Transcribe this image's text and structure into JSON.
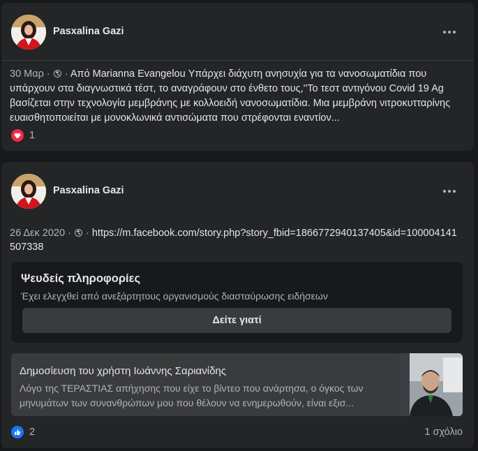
{
  "posts": [
    {
      "author": "Pasxalina Gazi",
      "date": "30 Μαρ",
      "separator": "·",
      "text": "Από Marianna Evangelou Υπάρχει διάχυτη ανησυχία για τα νανοσωματίδια που υπάρχουν στα διαγνωστικά τέστ, το αναγράφουν στο ένθετο τους,''Το τεστ αντιγόνου Covid 19 Ag βασίζεται στην τεχνολογία μεμβράνης με κολλοειδή νανοσωματίδια. Μια μεμβράνη νιτροκυτταρίνης ευαισθητοποιείται με μονοκλωνικά αντισώματα που στρέφονται εναντίον...",
      "reaction_icon": "love-icon",
      "reaction_count": "1"
    },
    {
      "author": "Pasxalina Gazi",
      "date": "26 Δεκ 2020",
      "separator": "·",
      "url": "https://m.facebook.com/story.php?story_fbid=1866772940137405&id=100004141507338",
      "fact_check": {
        "title": "Ψευδείς πληροφορίες",
        "subtitle": "Έχει ελεγχθεί από ανεξάρτητους οργανισμούς διασταύρωσης ειδήσεων",
        "button": "Δείτε γιατί"
      },
      "shared": {
        "title": "Δημοσίευση του χρήστη Ιωάννης Σαριανίδης",
        "description": "Λόγο της ΤΕΡΑΣΤΙΑΣ απήχησης που είχε το βίντεο που ανάρτησα, ο όγκος των μηνυμάτων των συνανθρώπων μου που θέλουν να ενημερωθούν, είναι εξισ..."
      },
      "reaction_icon": "like-icon",
      "reaction_count": "2",
      "comments": "1 σχόλιο"
    }
  ],
  "colors": {
    "background": "#18191a",
    "card": "#242526",
    "love": "#f0284a",
    "like": "#1877f2"
  }
}
